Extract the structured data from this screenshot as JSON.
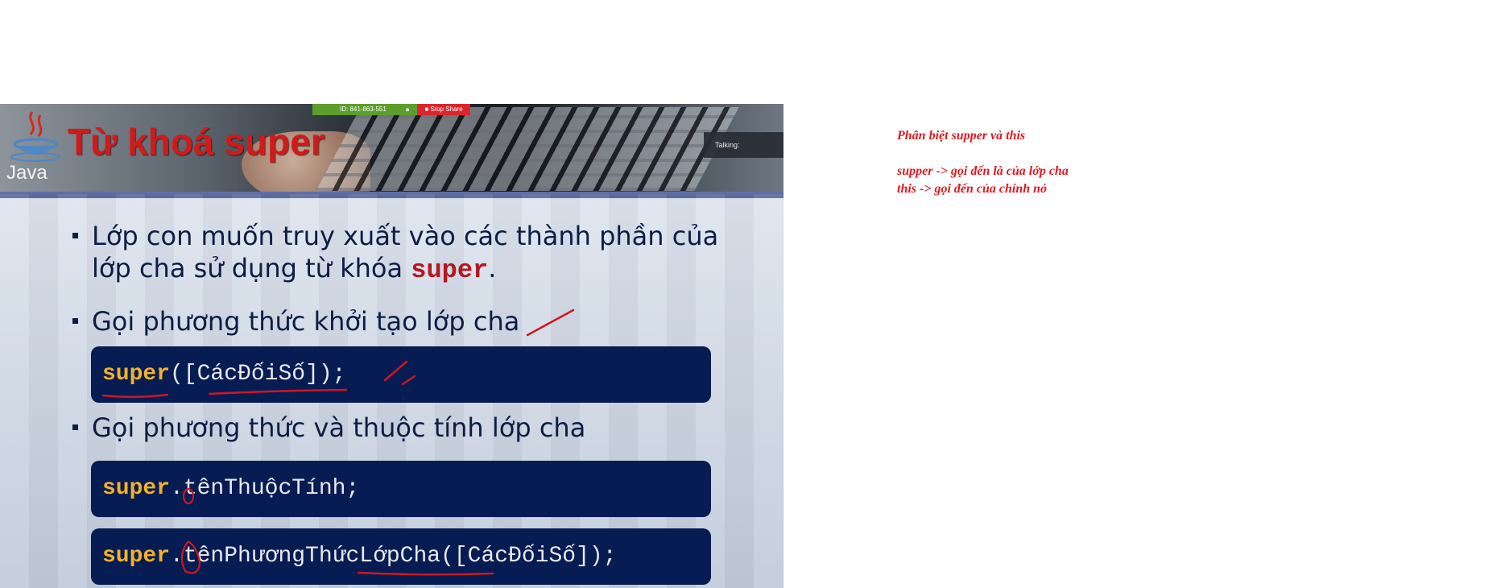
{
  "slide": {
    "title": "Từ khoá super",
    "logo_text": "Java",
    "zoom_bar": {
      "meeting_id": "ID: 841-863-551",
      "stop_share_label": "Stop Share"
    },
    "talking_label": "Talking:",
    "bullets": [
      {
        "text_before": "Lớp con muốn truy xuất vào các thành phần của lớp cha sử dụng từ khóa ",
        "keyword": "super",
        "text_after": "."
      },
      {
        "text": "Gọi phương thức khởi tạo lớp cha"
      },
      {
        "text": "Gọi phương thức và thuộc tính lớp cha"
      }
    ],
    "code_blocks": [
      {
        "keyword": "super",
        "rest": "([CácĐốiSố]);"
      },
      {
        "keyword": "super",
        "rest": ".tênThuộcTính;"
      },
      {
        "keyword": "super",
        "rest": ".tênPhươngThứcLớpCha([CácĐốiSố]);"
      }
    ]
  },
  "notes": {
    "heading": "Phân biệt supper và this",
    "line_1": "supper -> gọi đến là của lớp cha",
    "line_2": "this -> gọi đến của chính nó"
  },
  "colors": {
    "notes_text": "#e0191f",
    "slide_title": "#d11a1a",
    "code_bg": "#061c53",
    "code_keyword": "#f2b126",
    "annotation_ink": "#d01622"
  },
  "icons": {
    "java_logo": "java-coffee-cup-icon",
    "lock": "lock-icon",
    "stop": "stop-square-icon"
  }
}
